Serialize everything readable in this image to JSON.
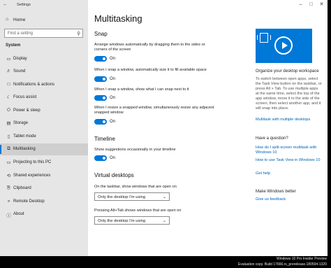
{
  "window": {
    "title": "Settings"
  },
  "sidebar": {
    "home_label": "Home",
    "search_placeholder": "Find a setting",
    "section_label": "System",
    "items": [
      {
        "label": "Display",
        "icon": "monitor-icon"
      },
      {
        "label": "Sound",
        "icon": "speaker-icon"
      },
      {
        "label": "Notifications & actions",
        "icon": "notification-icon"
      },
      {
        "label": "Focus assist",
        "icon": "moon-icon"
      },
      {
        "label": "Power & sleep",
        "icon": "power-icon"
      },
      {
        "label": "Storage",
        "icon": "storage-icon"
      },
      {
        "label": "Tablet mode",
        "icon": "tablet-icon"
      },
      {
        "label": "Multitasking",
        "icon": "multitasking-icon",
        "active": true
      },
      {
        "label": "Projecting to this PC",
        "icon": "projector-icon"
      },
      {
        "label": "Shared experiences",
        "icon": "shared-icon"
      },
      {
        "label": "Clipboard",
        "icon": "clipboard-icon"
      },
      {
        "label": "Remote Desktop",
        "icon": "remote-desktop-icon"
      },
      {
        "label": "About",
        "icon": "info-icon"
      }
    ]
  },
  "main": {
    "title": "Multitasking",
    "snap": {
      "heading": "Snap",
      "settings": [
        {
          "desc": "Arrange windows automatically by dragging them to the sides or corners of the screen",
          "state": "On"
        },
        {
          "desc": "When I snap a window, automatically size it to fill available space",
          "state": "On"
        },
        {
          "desc": "When I snap a window, show what I can snap next to it",
          "state": "On"
        },
        {
          "desc": "When I resize a snapped window, simultaneously resize any adjacent snapped window",
          "state": "On"
        }
      ]
    },
    "timeline": {
      "heading": "Timeline",
      "desc": "Show suggestions occasionally in your timeline",
      "state": "On"
    },
    "virtual_desktops": {
      "heading": "Virtual desktops",
      "taskbar_label": "On the taskbar, show windows that are open on",
      "taskbar_value": "Only the desktop I'm using",
      "alttab_label": "Pressing Alt+Tab shows windows that are open on",
      "alttab_value": "Only the desktop I'm using"
    }
  },
  "right": {
    "organize_heading": "Organize your desktop workspace",
    "organize_text": "To switch between open apps, select the Task View button on the taskbar, or press Alt + Tab. To use multiple apps at the same time, select the top of the app window, move it to the side of the screen, then select another app, and it will snap into place.",
    "organize_link": "Multitask with multiple desktops",
    "question_heading": "Have a question?",
    "links": [
      "How do I split-screen multitask with Windows 10",
      "How to use Task View in Windows 10",
      "Get help"
    ],
    "better_heading": "Make Windows better",
    "feedback_link": "Give us feedback"
  },
  "watermark": {
    "line1": "Windows 10 Pro Insider Preview",
    "line2": "Evaluation copy. Build 17666.rs_prerelease.180504-1320"
  },
  "colors": {
    "accent": "#0078d7",
    "link": "#0063b1",
    "sidebar_bg": "#e6e6e6"
  }
}
